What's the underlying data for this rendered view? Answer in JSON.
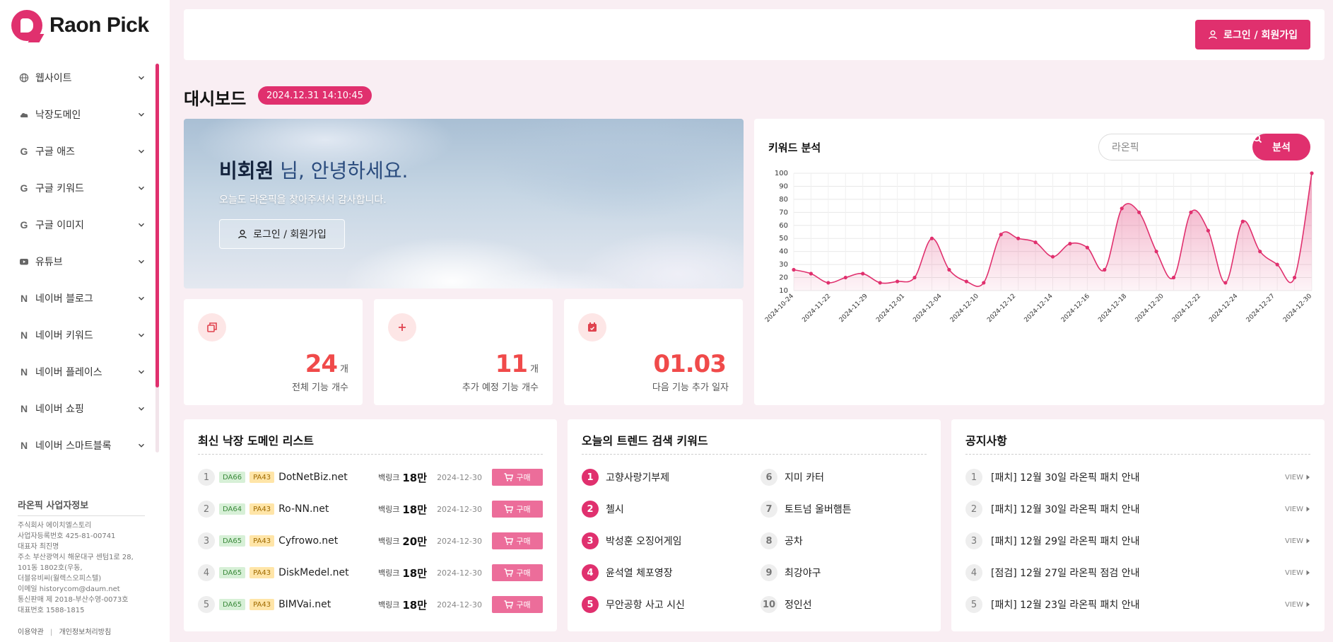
{
  "brand": {
    "name": "Raon Pick"
  },
  "sidebar": {
    "items": [
      {
        "label": "웹사이트",
        "icon": "globe-icon"
      },
      {
        "label": "낙장도메인",
        "icon": "cloud-icon"
      },
      {
        "label": "구글 애즈",
        "icon": "google-icon"
      },
      {
        "label": "구글 키워드",
        "icon": "google-icon"
      },
      {
        "label": "구글 이미지",
        "icon": "google-icon"
      },
      {
        "label": "유튜브",
        "icon": "youtube-icon"
      },
      {
        "label": "네이버 블로그",
        "icon": "naver-icon"
      },
      {
        "label": "네이버 키워드",
        "icon": "naver-icon"
      },
      {
        "label": "네이버 플레이스",
        "icon": "naver-icon"
      },
      {
        "label": "네이버 쇼핑",
        "icon": "naver-icon"
      },
      {
        "label": "네이버 스마트블록",
        "icon": "naver-icon"
      }
    ],
    "biz": {
      "title": "라온픽 사업자정보",
      "lines": [
        "주식회사 에이치엘스토리",
        "사업자등록번호  425-81-00741",
        "대표자  최진명",
        "주소  부산광역시 해운대구 센텀1로 28,",
        "101동 1802호(우동,",
        "더블유비씨(월렉스오피스텔)",
        "이메일  historycom@daum.net",
        "통신판매  제 2018-부산수영-0073호",
        "대표번호  1588-1815"
      ],
      "footer_terms": "이용약관",
      "footer_privacy": "개인정보처리방침"
    }
  },
  "header": {
    "login_label": "로그인 / 회원가입"
  },
  "dashboard": {
    "title": "대시보드",
    "datetime": "2024.12.31 14:10:45",
    "hero": {
      "user": "비회원",
      "greeting": " 님, 안녕하세요.",
      "sub": "오늘도 라온픽을 찾아주셔서 감사합니다.",
      "button": "로그인 / 회원가입"
    },
    "stats": [
      {
        "value": "24",
        "unit": "개",
        "label": "전체 기능 개수",
        "icon": "copy-icon"
      },
      {
        "value": "11",
        "unit": "개",
        "label": "추가 예정 기능 개수",
        "icon": "plus-icon"
      },
      {
        "value": "01.03",
        "unit": "",
        "label": "다음 기능 추가 일자",
        "icon": "calendar-icon"
      }
    ]
  },
  "keyword": {
    "title": "키워드 분석",
    "search_value": "라온픽",
    "button": "분석"
  },
  "chart_data": {
    "type": "area",
    "title": "",
    "xlabel": "",
    "ylabel": "",
    "ylim": [
      10,
      100
    ],
    "yticks": [
      10,
      20,
      30,
      40,
      50,
      60,
      70,
      80,
      90,
      100
    ],
    "grid": true,
    "xtick_labels": [
      "2024-10-24",
      "2024-11-22",
      "2024-11-29",
      "2024-12-01",
      "2024-12-04",
      "2024-12-10",
      "2024-12-12",
      "2024-12-14",
      "2024-12-16",
      "2024-12-18",
      "2024-12-20",
      "2024-12-22",
      "2024-12-24",
      "2024-12-27",
      "2024-12-30"
    ],
    "values": [
      26,
      23,
      16,
      20,
      23,
      16,
      17,
      20,
      50,
      26,
      17,
      16,
      53,
      50,
      47,
      36,
      46,
      43,
      26,
      73,
      70,
      40,
      20,
      70,
      56,
      16,
      63,
      40,
      30,
      20,
      100
    ],
    "color": "#e0306e"
  },
  "domains": {
    "title": "최신 낙장 도메인 리스트",
    "backlink_label": "백링크",
    "buy_label": "구매",
    "rows": [
      {
        "n": "1",
        "da": "DA66",
        "pa": "PA43",
        "domain": "DotNetBiz.net",
        "backlinks": "18만",
        "date": "2024-12-30"
      },
      {
        "n": "2",
        "da": "DA64",
        "pa": "PA43",
        "domain": "Ro-NN.net",
        "backlinks": "18만",
        "date": "2024-12-30"
      },
      {
        "n": "3",
        "da": "DA65",
        "pa": "PA43",
        "domain": "Cyfrowo.net",
        "backlinks": "20만",
        "date": "2024-12-30"
      },
      {
        "n": "4",
        "da": "DA65",
        "pa": "PA43",
        "domain": "DiskMedel.net",
        "backlinks": "18만",
        "date": "2024-12-30"
      },
      {
        "n": "5",
        "da": "DA65",
        "pa": "PA43",
        "domain": "BIMVai.net",
        "backlinks": "18만",
        "date": "2024-12-30"
      }
    ]
  },
  "trends": {
    "title": "오늘의 트렌드 검색 키워드",
    "items": [
      {
        "n": "1",
        "text": "고향사랑기부제"
      },
      {
        "n": "2",
        "text": "첼시"
      },
      {
        "n": "3",
        "text": "박성훈 오징어게임"
      },
      {
        "n": "4",
        "text": "윤석열 체포영장"
      },
      {
        "n": "5",
        "text": "무안공항 사고 시신"
      },
      {
        "n": "6",
        "text": "지미 카터"
      },
      {
        "n": "7",
        "text": "토트넘 울버햄튼"
      },
      {
        "n": "8",
        "text": "공차"
      },
      {
        "n": "9",
        "text": "최강야구"
      },
      {
        "n": "10",
        "text": "정인선"
      }
    ]
  },
  "notices": {
    "title": "공지사항",
    "view_label": "VIEW",
    "items": [
      {
        "n": "1",
        "text": "[패치] 12월 30일 라온픽 패치 안내"
      },
      {
        "n": "2",
        "text": "[패치] 12월 30일 라온픽 패치 안내"
      },
      {
        "n": "3",
        "text": "[패치] 12월 29일 라온픽 패치 안내"
      },
      {
        "n": "4",
        "text": "[점검] 12월 27일 라온픽 점검 안내"
      },
      {
        "n": "5",
        "text": "[패치] 12월 23일 라온픽 패치 안내"
      }
    ]
  }
}
